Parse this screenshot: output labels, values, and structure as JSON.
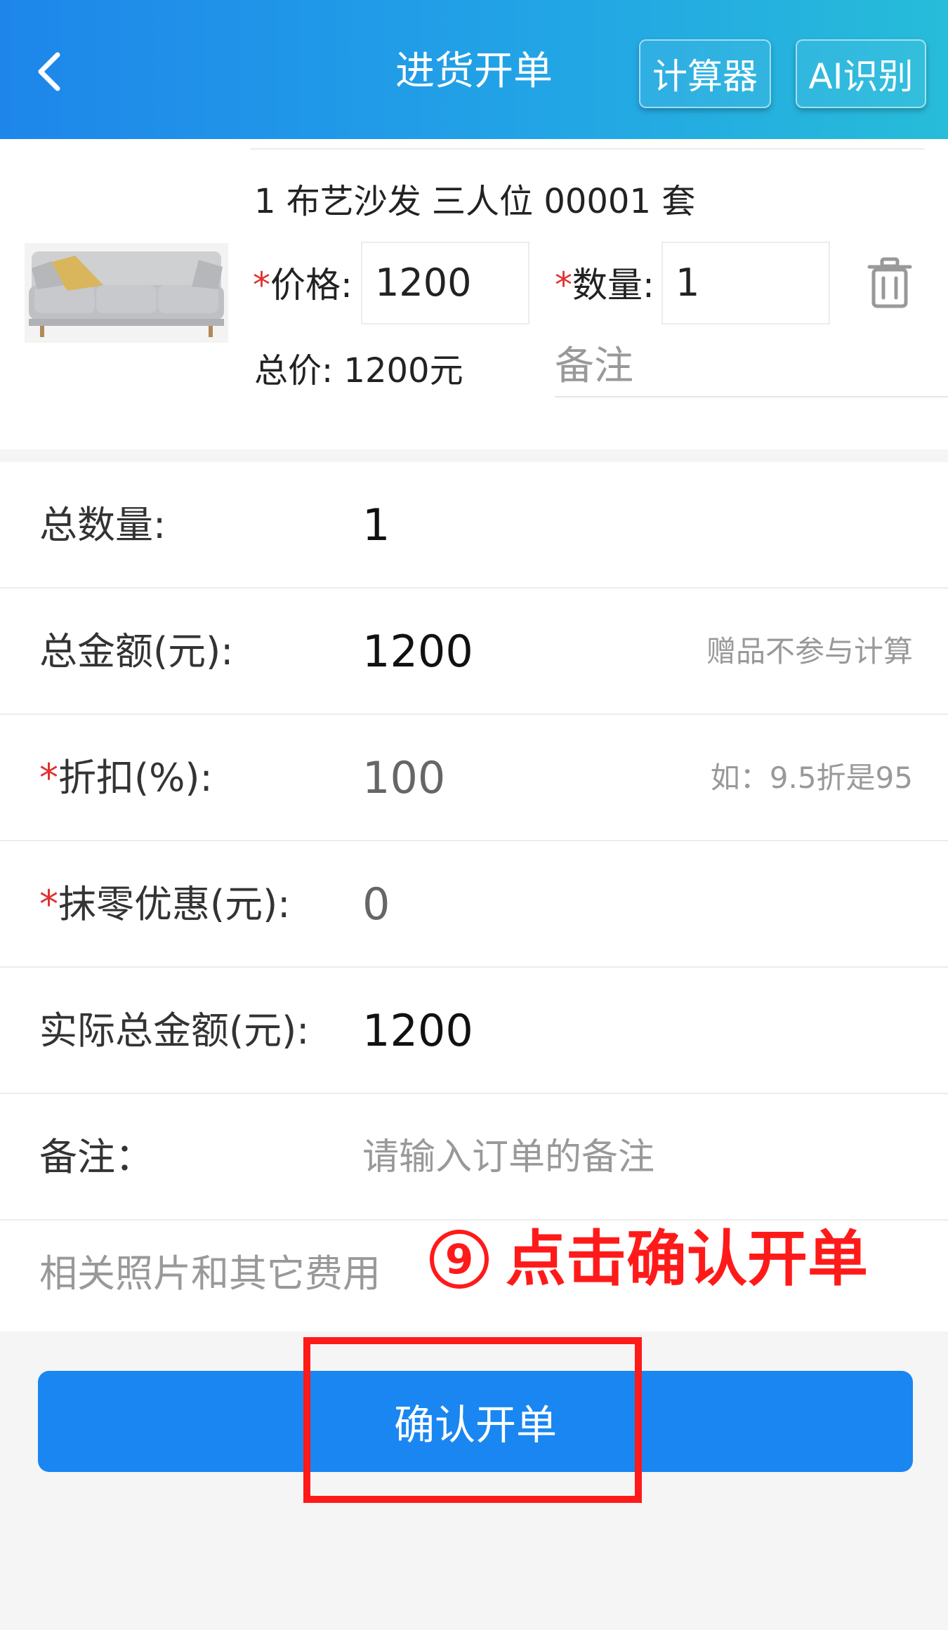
{
  "header": {
    "title": "进货开单",
    "calculator_label": "计算器",
    "ai_label": "AI识别"
  },
  "product": {
    "name": "1 布艺沙发 三人位 00001 套",
    "price_label": "价格:",
    "price_value": "1200",
    "qty_label": "数量:",
    "qty_value": "1",
    "total_label": "总价: 1200元",
    "remark_placeholder": "备注",
    "required_mark": "*"
  },
  "summary": {
    "total_qty_label": "总数量:",
    "total_qty_value": "1",
    "total_amount_label": "总金额(元):",
    "total_amount_value": "1200",
    "total_amount_hint": "赠品不参与计算",
    "discount_label": "折扣(%):",
    "discount_value": "100",
    "discount_hint": "如：9.5折是95",
    "rounding_label": "抹零优惠(元):",
    "rounding_value": "0",
    "actual_amount_label": "实际总金额(元):",
    "actual_amount_value": "1200",
    "remark_label": "备注：",
    "remark_placeholder": "请输入订单的备注",
    "photos_label": "相关照片和其它费用"
  },
  "annotation": {
    "number": "9",
    "text": "点击确认开单"
  },
  "confirm_button": "确认开单",
  "colors": {
    "header_start": "#1e86ea",
    "header_end": "#27bcd9",
    "primary": "#1a86f2",
    "annotation_red": "#ff1a1a",
    "required_red": "#e03030"
  }
}
